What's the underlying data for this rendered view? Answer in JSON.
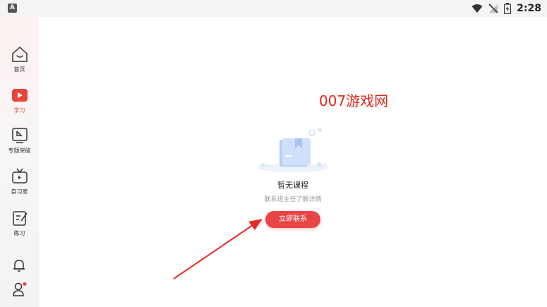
{
  "status_bar": {
    "app_icon_letter": "A",
    "time": "2:28"
  },
  "sidebar": {
    "items": [
      {
        "label": "首页",
        "icon": "home-icon"
      },
      {
        "label": "学习",
        "icon": "play-icon",
        "active": true
      },
      {
        "label": "专题突破",
        "icon": "breakthrough-icon"
      },
      {
        "label": "自习室",
        "icon": "tv-icon"
      },
      {
        "label": "练习",
        "icon": "practice-icon"
      }
    ],
    "bottom": [
      {
        "icon": "bell-icon"
      },
      {
        "icon": "user-icon",
        "badge_color": "#e8443b"
      }
    ]
  },
  "watermark": "007游戏网",
  "empty_state": {
    "title": "暂无课程",
    "subtitle": "联系班主任了解详情",
    "button_label": "立即联系"
  },
  "colors": {
    "accent": "#e84547",
    "watermark": "#e0261e"
  }
}
